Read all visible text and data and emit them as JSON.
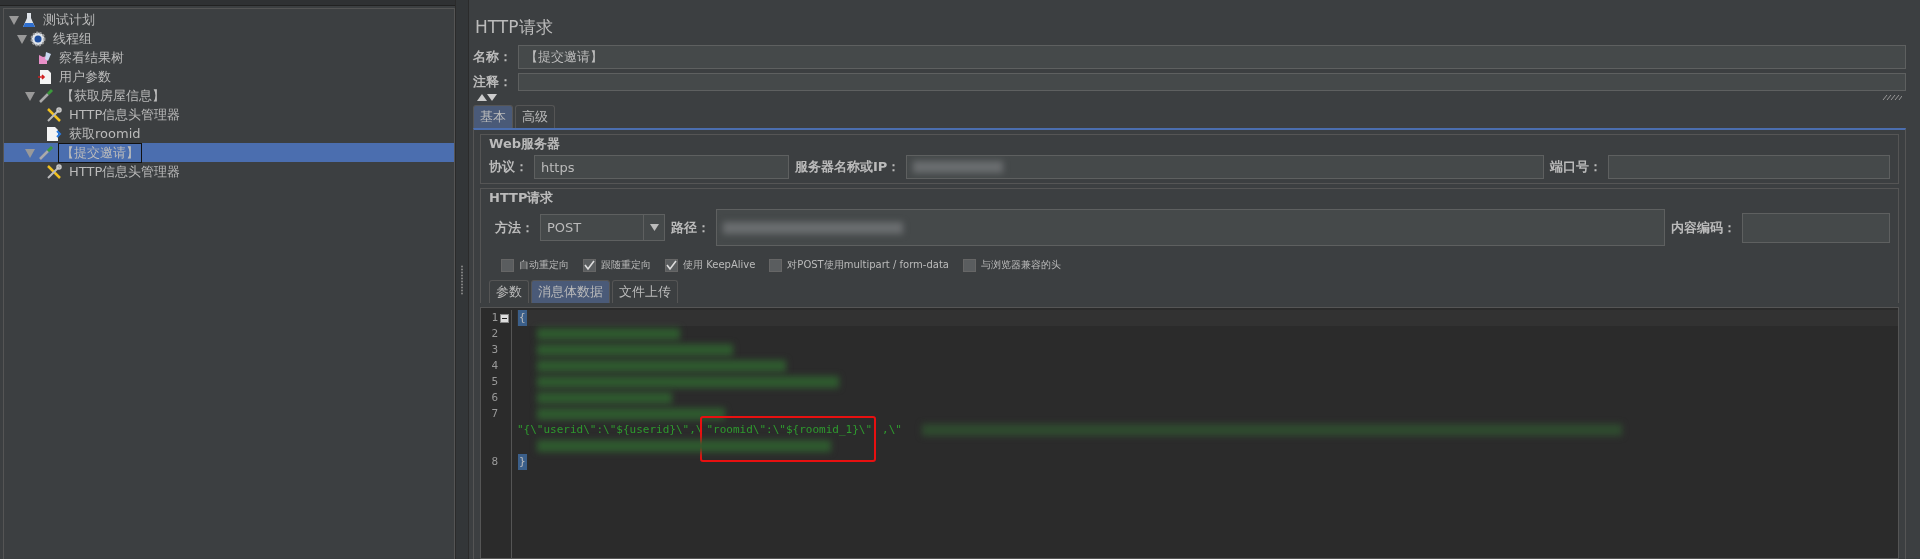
{
  "tree": [
    {
      "label": "测试计划",
      "kind": "flask",
      "expanded": true,
      "selected": false,
      "children": [
        {
          "label": "线程组",
          "kind": "gear",
          "expanded": true,
          "selected": false,
          "children": [
            {
              "label": "察看结果树",
              "kind": "chart",
              "selected": false
            },
            {
              "label": "用户参数",
              "kind": "doc-in",
              "selected": false
            },
            {
              "label": "【获取房屋信息】",
              "kind": "pipette",
              "expanded": true,
              "selected": false,
              "children": [
                {
                  "label": "HTTP信息头管理器",
                  "kind": "tools",
                  "selected": false
                },
                {
                  "label": "获取roomid",
                  "kind": "doc-out",
                  "selected": false
                }
              ]
            },
            {
              "label": "【提交邀请】",
              "kind": "pipette",
              "expanded": true,
              "selected": true,
              "children": [
                {
                  "label": "HTTP信息头管理器",
                  "kind": "tools",
                  "selected": false
                }
              ]
            }
          ]
        }
      ]
    }
  ],
  "panel": {
    "title": "HTTP请求",
    "name_label": "名称：",
    "name_value": "【提交邀请】",
    "comment_label": "注释：",
    "tabs": [
      {
        "label": "基本",
        "selected": true
      },
      {
        "label": "高级",
        "selected": false
      }
    ],
    "web_server": {
      "title": "Web服务器",
      "protocol_label": "协议：",
      "protocol_value": "https",
      "server_label": "服务器名称或IP：",
      "server_redacted": true,
      "port_label": "端口号："
    },
    "http_request": {
      "title": "HTTP请求",
      "method_label": "方法：",
      "method_value": "POST",
      "path_label": "路径：",
      "path_redacted": true,
      "encoding_label": "内容编码：",
      "options": [
        {
          "label": "自动重定向",
          "checked": false
        },
        {
          "label": "跟随重定向",
          "checked": true
        },
        {
          "label": "使用 KeepAlive",
          "checked": true
        },
        {
          "label": "对POST使用multipart / form-data",
          "checked": false
        },
        {
          "label": "与浏览器兼容的头",
          "checked": false
        }
      ],
      "body_tabs": [
        {
          "label": "参数",
          "selected": false
        },
        {
          "label": "消息体数据",
          "selected": true
        },
        {
          "label": "文件上传",
          "selected": false
        }
      ]
    },
    "editor": {
      "rows": [
        {
          "kind": "brace",
          "number": "1",
          "text": "{",
          "fold": true
        },
        {
          "kind": "redacted",
          "number": "2"
        },
        {
          "kind": "redacted",
          "number": "3"
        },
        {
          "kind": "redacted",
          "number": "4"
        },
        {
          "kind": "redacted",
          "number": "5"
        },
        {
          "kind": "redacted",
          "number": "6"
        },
        {
          "kind": "redacted",
          "number": "7"
        },
        {
          "kind": "code",
          "before": "\"{\\\"userid\\\":\\\"${userid}\\\",\\",
          "highlighted": "\"roomid\\\":\\\"${roomid_1}\\\"",
          "after": ",\\\""
        },
        {
          "kind": "redacted"
        },
        {
          "kind": "brace",
          "number": "8",
          "text": "}"
        }
      ]
    }
  }
}
